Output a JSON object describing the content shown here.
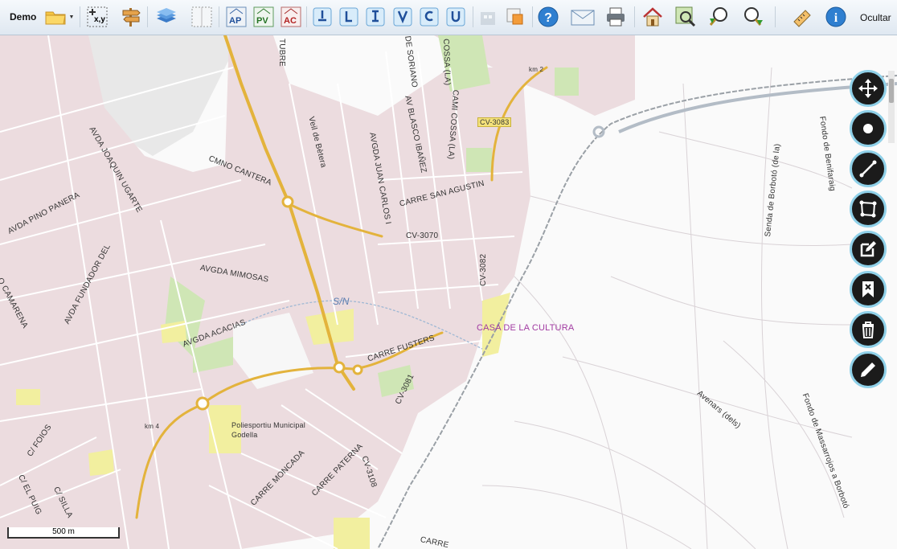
{
  "toolbar": {
    "title": "Demo",
    "hide_label": "Ocultar",
    "xy_label": "x,y",
    "ap_label": "AP",
    "pv_label": "PV",
    "ac_label": "AC"
  },
  "map": {
    "labels": {
      "avda_joaquin_ugarte": "AVDA JOAQUIN UGARTE",
      "avda_pino_panera": "AVDA PINO PANERA",
      "avda_fundador_del": "AVDA FUNDADOR DEL",
      "camarena": "O CAMARENA",
      "cmno_cantera": "CMNO CANTERA",
      "veil_de_betera": "Veil de Bètera",
      "avgda_juan_carlos": "AVGDA JUAN CARLOS I",
      "av_blasco_ibanez": "AV BLASCO IBAÑEZ",
      "de_soriano": "DE SORIANO",
      "cami_cossa": "CAMI COSSA (LA)",
      "cossa": "COSSA (LA)",
      "tubre": "TUBRE",
      "km2": "km 2",
      "cv3083": "CV-3083",
      "carre_san_agustin": "CARRE SAN AGUSTIN",
      "cv3070": "CV-3070",
      "cv3082": "CV-3082",
      "avgda_mimosas": "AVGDA MIMOSAS",
      "avgda_acacias": "AVGDA ACACIAS",
      "sn": "S/N",
      "casa_cultura": "CASA DE LA CULTURA",
      "carre_fusters": "CARRE FUSTERS",
      "cv3081": "CV-3081",
      "km4": "km 4",
      "polisportiu": "Poliesportiu Municipal",
      "godella": "Godella",
      "c_foios": "C/ FOIOS",
      "c_el_puig": "C/ EL PUIG",
      "c_silla": "C/ SILLA",
      "carre_moncada": "CARRE MONCADA",
      "carre_paterna": "CARRE PATERNA",
      "cv3108": "CV-3108",
      "carre_bottom": "CARRE",
      "senda_borboto": "Senda de Borbotó (de la)",
      "fondo_benifaraig": "Fondo de Benifaraig",
      "avenars": "Avenars (dels)",
      "fondo_massarrojos": "Fondo de Massarrojos a Borbotó"
    },
    "scale": "500 m"
  },
  "colors": {
    "urban": "#ecdcdf",
    "block_outline": "#ffffff",
    "main_road": "#e3b33c",
    "park": "#cfe6b5",
    "yellow_area": "#f2ef9f",
    "tool_bg": "#1b1b1b",
    "tool_ring": "#8fd0e8"
  }
}
